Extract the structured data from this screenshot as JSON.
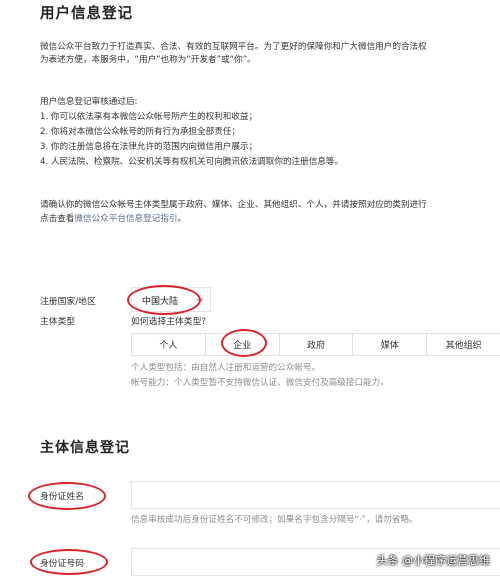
{
  "page": {
    "title": "用户信息登记",
    "intro_line1": "微信公众平台致力于打造真实、合法、有效的互联网平台。为了更好的保障你和广大微信用户的合法权",
    "intro_line2": "为表述方便，本服务中，“用户”也称为“开发者”或“你”。",
    "review_heading": "用户信息登记审核通过后:",
    "review_items": [
      "1.  你可以依法享有本微信公众帐号所产生的权利和收益；",
      "2.  你将对本微信公众帐号的所有行为承担全部责任；",
      "3.  你的注册信息将在法律允许的范围内向微信用户展示；",
      "4.  人民法院、检察院、公安机关等有权机关可向腾讯依法调取你的注册信息等。"
    ],
    "confirm_line1": "请确认你的微信公众帐号主体类型属于政府、媒体、企业、其他组织、个人，并请按照对应的类别进行",
    "confirm_prefix": "点击查看",
    "confirm_link": "微信公众平台信息登记指引",
    "confirm_suffix": "。"
  },
  "form": {
    "country_label": "注册国家/地区",
    "country_value": "中国大陆",
    "subject_label": "主体类型",
    "subject_help_link": "如何选择主体类型?",
    "subject_options": [
      "个人",
      "企业",
      "政府",
      "媒体",
      "其他组织"
    ],
    "selected_option": "企业",
    "personal_desc": "个人类型包括：由自然人注册和运营的公众帐号。",
    "personal_ability": "帐号能力：个人类型暂不支持微信认证、微信支付及高级接口能力。"
  },
  "subject_info": {
    "title": "主体信息登记",
    "id_name_label": "身份证姓名",
    "id_name_hint": "信息审核成功后身份证姓名不可修改；如果名字包含分隔号“·”，请勿省略。",
    "id_number_label": "身份证号码"
  },
  "watermark": {
    "text": "头条 @小程序运营思维"
  },
  "colors": {
    "link": "#576b95",
    "annotation": "#d9232d",
    "muted": "#8d8d8d"
  }
}
